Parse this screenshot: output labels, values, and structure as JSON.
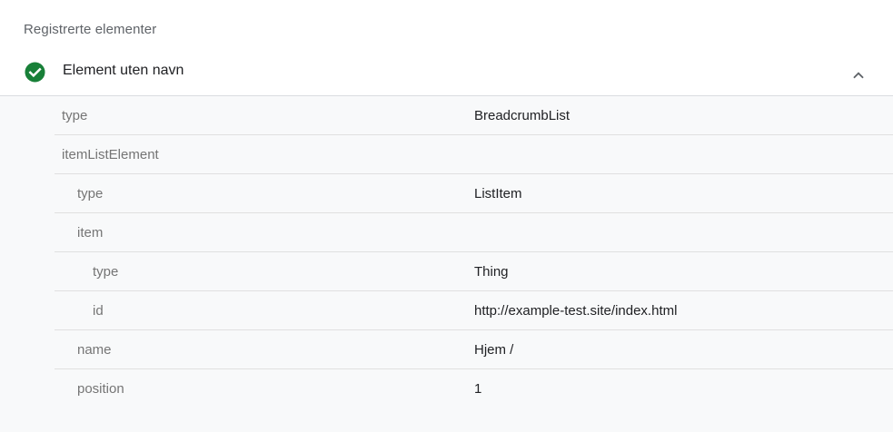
{
  "section_title": "Registrerte elementer",
  "item": {
    "title": "Element uten navn",
    "status_icon": "check-circle-icon",
    "status_color": "#188038",
    "toggle_icon": "chevron-up-icon"
  },
  "rows": [
    {
      "property": "type",
      "value": "BreadcrumbList",
      "level": 0
    },
    {
      "property": "itemListElement",
      "value": "",
      "level": 0
    },
    {
      "property": "type",
      "value": "ListItem",
      "level": 1
    },
    {
      "property": "item",
      "value": "",
      "level": 1
    },
    {
      "property": "type",
      "value": "Thing",
      "level": 2
    },
    {
      "property": "id",
      "value": "http://example-test.site/index.html",
      "level": 2
    },
    {
      "property": "name",
      "value": "Hjem /",
      "level": 1
    },
    {
      "property": "position",
      "value": "1",
      "level": 1
    }
  ]
}
